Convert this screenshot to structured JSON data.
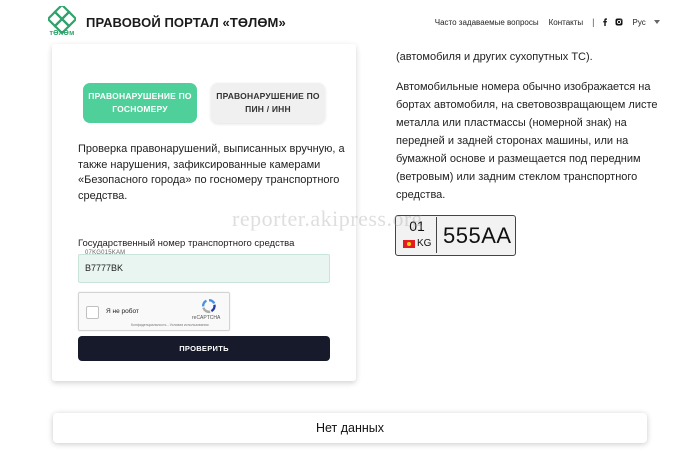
{
  "header": {
    "logo_text": "тӨлӨм",
    "title": "ПРАВОВОЙ ПОРТАЛ «ТӨЛӨМ»",
    "nav": {
      "faq": "Часто задаваемые вопросы",
      "contacts": "Контакты",
      "separator": "|",
      "language": "Рус"
    },
    "colors": {
      "brand": "#2fa36b"
    }
  },
  "form": {
    "tab_plate": "ПРАВОНАРУШЕНИЕ ПО ГОСНОМЕРУ",
    "tab_pin": "ПРАВОНАРУШЕНИЕ ПО ПИН / ИНН",
    "description": "Проверка правонарушений, выписанных вручную, а также нарушения, зафиксированные камерами «Безопасного города» по госномеру транспортного средства.",
    "field_label": "Государственный номер транспортного средства",
    "input_placeholder": "07KG015KAM",
    "input_value": "B7777BK",
    "captcha_label": "Я не робот",
    "captcha_brand": "reCAPTCHA",
    "captcha_terms": "Конфиденциальность - Условия использования",
    "submit_label": "ПРОВЕРИТЬ",
    "colors": {
      "active_tab": "#4fd09a",
      "submit": "#161a2a",
      "input_bg": "#e9f5f1"
    }
  },
  "info": {
    "top_text": "(автомобиля и других сухопутных ТС).",
    "body_text": "Автомобильные номера обычно изображается на бортах автомобиля, на световозвращающем листе металла или пластмассы (номерной знак) на передней и задней сторонах машины, или на бумажной основе и размещается под передним (ветровым) или задним стеклом транспортного средства."
  },
  "plate": {
    "region": "01",
    "country": "KG",
    "number": "555AA"
  },
  "watermark": "reporter.akipress.org",
  "result": {
    "text": "Нет данных"
  }
}
